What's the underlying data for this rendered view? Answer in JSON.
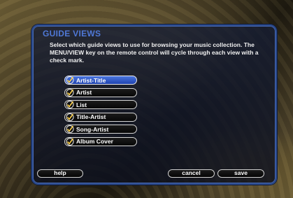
{
  "dialog": {
    "title": "GUIDE VIEWS",
    "description": "Select which guide views to use for browsing your music collection. The MENU/VIEW key on the remote control will cycle through each view with a check mark."
  },
  "views": [
    {
      "label": "Artist-Title",
      "checked": true,
      "selected": true
    },
    {
      "label": "Artist",
      "checked": true,
      "selected": false
    },
    {
      "label": "List",
      "checked": true,
      "selected": false
    },
    {
      "label": "Title-Artist",
      "checked": true,
      "selected": false
    },
    {
      "label": "Song-Artist",
      "checked": true,
      "selected": false
    },
    {
      "label": "Album Cover",
      "checked": true,
      "selected": false
    }
  ],
  "buttons": {
    "help": "help",
    "cancel": "cancel",
    "save": "save"
  },
  "colors": {
    "title": "#4f78d6",
    "selected_item": "#3a63d0",
    "panel_border": "#2b4a8c"
  },
  "icons": {
    "check": "check-mark-icon"
  }
}
